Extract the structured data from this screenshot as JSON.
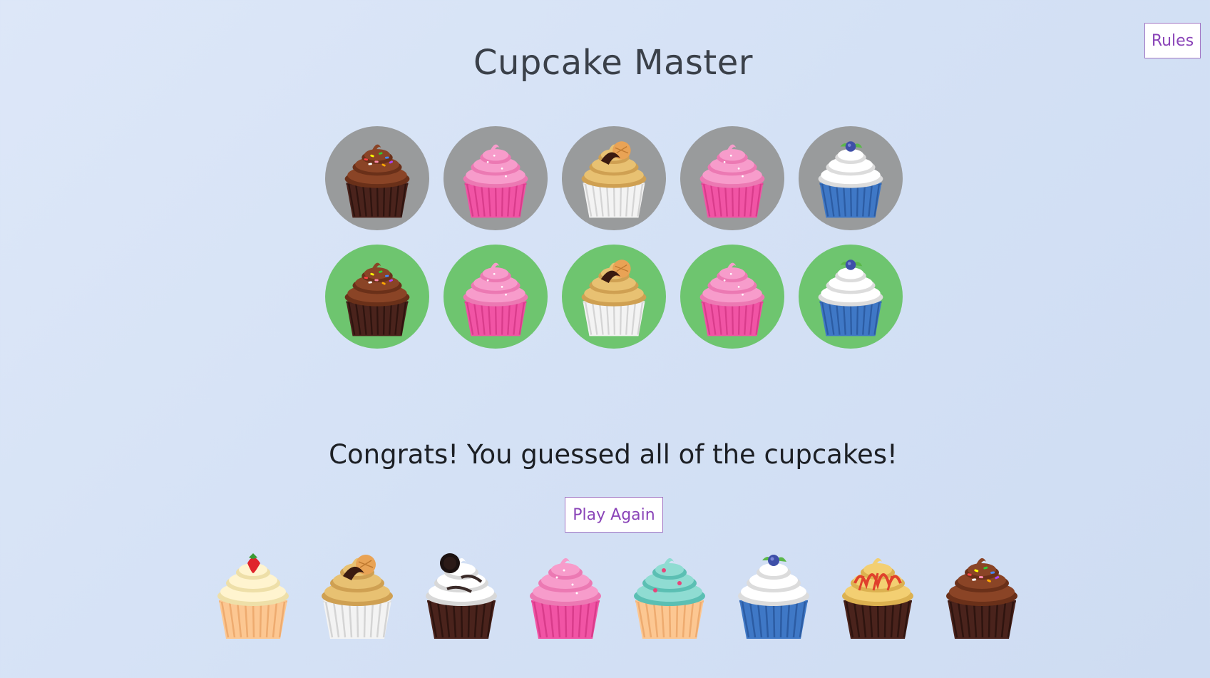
{
  "header": {
    "title": "Cupcake Master",
    "rules_label": "Rules"
  },
  "board": {
    "guess_row": [
      {
        "cupcake": "chocolate-sprinkles",
        "feedback": "grey"
      },
      {
        "cupcake": "pink-swirl",
        "feedback": "grey"
      },
      {
        "cupcake": "caramel-cookie",
        "feedback": "grey"
      },
      {
        "cupcake": "pink-swirl",
        "feedback": "grey"
      },
      {
        "cupcake": "blueberry",
        "feedback": "grey"
      }
    ],
    "answer_row": [
      {
        "cupcake": "chocolate-sprinkles",
        "feedback": "green"
      },
      {
        "cupcake": "pink-swirl",
        "feedback": "green"
      },
      {
        "cupcake": "caramel-cookie",
        "feedback": "green"
      },
      {
        "cupcake": "pink-swirl",
        "feedback": "green"
      },
      {
        "cupcake": "blueberry",
        "feedback": "green"
      }
    ]
  },
  "status": {
    "message": "Congrats! You guessed all of the cupcakes!",
    "play_again_label": "Play Again"
  },
  "palette": [
    "strawberry",
    "caramel-cookie",
    "cookies-and-cream",
    "pink-swirl",
    "mint",
    "blueberry",
    "caramel-drizzle",
    "chocolate-sprinkles"
  ],
  "colors": {
    "background": "#d8e3f6",
    "feedback_grey": "#999b9c",
    "feedback_green": "#6ec56f",
    "button_border": "#a277c4",
    "button_text": "#8a44b8",
    "title_text": "#3a4049"
  }
}
